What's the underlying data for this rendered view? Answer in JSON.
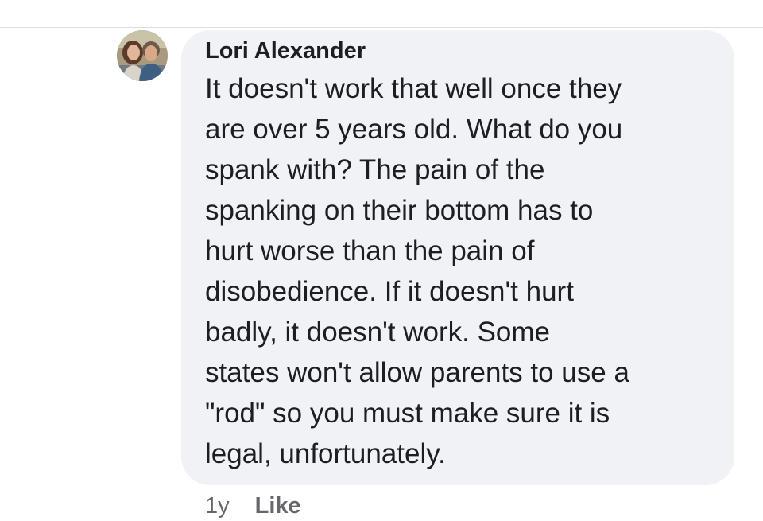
{
  "comment": {
    "author": "Lori Alexander",
    "lines": [
      "It doesn't work that well once they",
      "are over 5 years old. What do you",
      "spank with? The pain of the",
      "spanking on their bottom has to",
      "hurt worse than the pain of",
      "disobedience. If it doesn't hurt",
      "badly, it doesn't work. Some",
      "states won't allow parents to use a",
      "\"rod\" so you must make sure it is",
      "legal, unfortunately."
    ],
    "timestamp": "1y",
    "like_label": "Like"
  },
  "colors": {
    "bubble": "#f0f2f5",
    "text": "#1c1e21",
    "meta": "#65676b",
    "divider": "#dadde1"
  }
}
